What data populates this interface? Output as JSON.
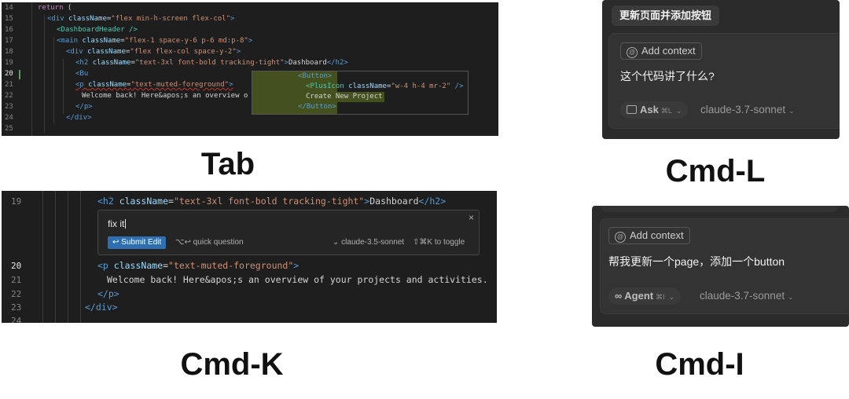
{
  "tab_panel": {
    "caption": "Tab",
    "lines": [
      {
        "num": "14"
      },
      {
        "num": "15"
      },
      {
        "num": "16"
      },
      {
        "num": "17"
      },
      {
        "num": "18"
      },
      {
        "num": "19"
      },
      {
        "num": "20"
      },
      {
        "num": "21"
      },
      {
        "num": "22"
      },
      {
        "num": "23"
      },
      {
        "num": "24"
      },
      {
        "num": "25"
      }
    ],
    "code": {
      "l14_kw": "return",
      "l14_rest": " (",
      "l15_a": "<div ",
      "l15_b": "className",
      "l15_c": "=",
      "l15_d": "\"flex min-h-screen flex-col\"",
      "l15_e": ">",
      "l16": "<DashboardHeader />",
      "l17_a": "<main ",
      "l17_b": "className",
      "l17_c": "=",
      "l17_d": "\"flex-1 space-y-6 p-6 md:p-8\"",
      "l17_e": ">",
      "l18_a": "<div ",
      "l18_b": "className",
      "l18_c": "=",
      "l18_d": "\"flex flex-col space-y-2\"",
      "l18_e": ">",
      "l19_a": "<h2 ",
      "l19_b": "className",
      "l19_c": "=",
      "l19_d": "\"text-3xl font-bold tracking-tight\"",
      "l19_e": ">",
      "l19_f": "Dashboard",
      "l19_g": "</h2>",
      "l20": "<Bu",
      "l21_a": "<p ",
      "l21_b": "className",
      "l21_c": "=",
      "l21_d": "\"text-muted-foreground\"",
      "l21_e": ">",
      "l22": "Welcome back! Here&apos;s an overview o",
      "l23": "</p>",
      "l24": "</div>"
    },
    "ghost": {
      "l1": "<Button>",
      "l2_a": "<PlusIcon ",
      "l2_b": "className",
      "l2_c": "=",
      "l2_d": "\"w-4 h-4 mr-2\"",
      "l2_e": " />",
      "l3": "Create New Project",
      "l4": "</Button>"
    }
  },
  "cmdk_panel": {
    "caption": "Cmd-K",
    "lines": {
      "l19": "19",
      "l20": "20",
      "l21": "21",
      "l22": "22",
      "l23": "23",
      "l24": "24"
    },
    "code": {
      "l19_a": "<h2 ",
      "l19_b": "className",
      "l19_c": "=",
      "l19_d": "\"text-3xl font-bold tracking-tight\"",
      "l19_e": ">",
      "l19_f": "Dashboard",
      "l19_g": "</h2>",
      "l20_a": "<p ",
      "l20_b": "className",
      "l20_c": "=",
      "l20_d": "\"text-muted-foreground\"",
      "l20_e": ">",
      "l21": "Welcome back! Here&apos;s an overview of your projects and activities.",
      "l22": "</p>",
      "l23": "</div>"
    },
    "popup": {
      "input_value": "fix it",
      "close": "×",
      "submit_label": "↩ Submit Edit",
      "quick_question": "⌥↩ quick question",
      "model": "⌄ claude-3.5-sonnet",
      "toggle": "⇧⌘K to toggle"
    }
  },
  "cmdl_panel": {
    "caption": "Cmd-L",
    "top_chip": "更新页面并添加按钮",
    "add_context": "Add context",
    "prompt": "这个代码讲了什么?",
    "mode": "Ask",
    "mode_shortcut": "⌘L",
    "model": "claude-3.7-sonnet"
  },
  "cmdi_panel": {
    "caption": "Cmd-I",
    "add_context": "Add context",
    "prompt": "帮我更新一个page，添加一个button",
    "mode": "Agent",
    "mode_shortcut": "⌘I",
    "model": "claude-3.7-sonnet"
  }
}
